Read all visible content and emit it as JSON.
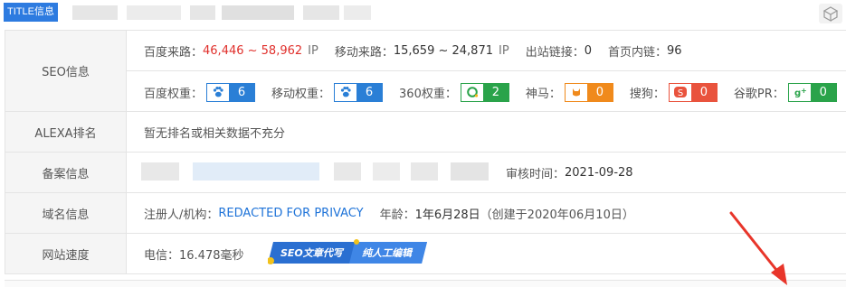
{
  "header": {
    "title_tag": "TITLE信息"
  },
  "seo": {
    "label": "SEO信息",
    "baidu_traffic_label": "百度来路：",
    "baidu_traffic_value": "46,446 ~ 58,962",
    "ip_unit_1": "IP",
    "mobile_traffic_label": "移动来路：",
    "mobile_traffic_value": "15,659 ~ 24,871",
    "ip_unit_2": "IP",
    "outbound_label": "出站链接：",
    "outbound_value": "0",
    "home_links_label": "首页内链：",
    "home_links_value": "96",
    "baidu_weight_label": "百度权重：",
    "baidu_weight_value": "6",
    "mobile_weight_label": "移动权重：",
    "mobile_weight_value": "6",
    "weight_360_label": "360权重：",
    "weight_360_value": "2",
    "shenma_label": "神马：",
    "shenma_value": "0",
    "sogou_label": "搜狗：",
    "sogou_value": "0",
    "google_pr_label": "谷歌PR：",
    "google_pr_value": "0"
  },
  "alexa": {
    "label": "ALEXA排名",
    "value": "暂无排名或相关数据不充分"
  },
  "icp": {
    "label": "备案信息",
    "review_time_label": "审核时间：",
    "review_time_value": "2021-09-28"
  },
  "domain": {
    "label": "域名信息",
    "registrant_label": "注册人/机构：",
    "registrant_value": "REDACTED FOR PRIVACY",
    "age_label": "年龄：",
    "age_value": "1年6月28日",
    "created_text": "（创建于2020年06月10日）"
  },
  "speed": {
    "label": "网站速度",
    "telecom_text": "电信：16.478毫秒",
    "promo_left": "SEO文章代写",
    "promo_right": "纯人工编辑"
  },
  "colors": {
    "title_tag_bg": "#2d7be0",
    "red": "#e0302c",
    "link_blue": "#1e73d8",
    "arrow": "#e8352a"
  },
  "icons": [
    "paw-icon",
    "paw-icon",
    "360-icon",
    "shenma-icon",
    "sogou-icon",
    "google-plus-icon",
    "cube-icon",
    "red-arrow"
  ]
}
